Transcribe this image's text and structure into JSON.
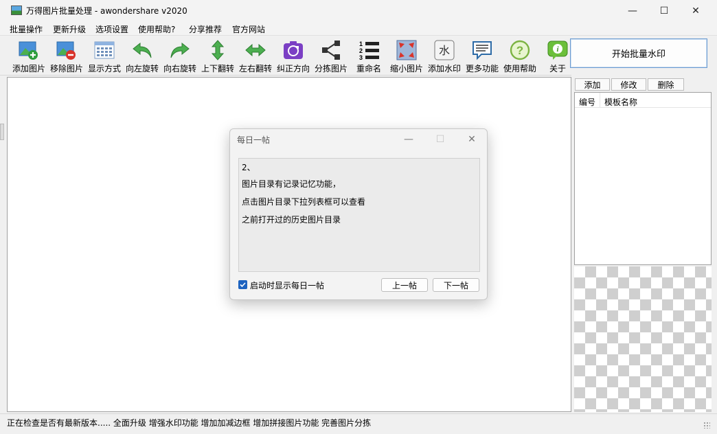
{
  "window": {
    "title": "万得图片批量处理 - awondershare v2020",
    "controls": {
      "minimize": "—",
      "maximize": "☐",
      "close": "✕"
    }
  },
  "menu": [
    "批量操作",
    "更新升级",
    "选项设置",
    "使用帮助?",
    "分享推荐",
    "官方网站"
  ],
  "toolbar": {
    "tools": [
      {
        "label": "添加图片",
        "icon": "add-image-icon"
      },
      {
        "label": "移除图片",
        "icon": "remove-image-icon"
      },
      {
        "label": "显示方式",
        "icon": "display-mode-icon"
      },
      {
        "label": "向左旋转",
        "icon": "rotate-left-icon"
      },
      {
        "label": "向右旋转",
        "icon": "rotate-right-icon"
      },
      {
        "label": "上下翻转",
        "icon": "flip-vertical-icon"
      },
      {
        "label": "左右翻转",
        "icon": "flip-horizontal-icon"
      },
      {
        "label": "纠正方向",
        "icon": "correct-orientation-icon"
      },
      {
        "label": "分拣图片",
        "icon": "sort-images-icon"
      },
      {
        "label": "重命名",
        "icon": "rename-icon",
        "glyph_numbers": [
          "1",
          "2",
          "3"
        ]
      },
      {
        "label": "缩小图片",
        "icon": "shrink-image-icon"
      },
      {
        "label": "添加水印",
        "icon": "add-watermark-icon",
        "glyph": "水"
      },
      {
        "label": "更多功能",
        "icon": "more-features-icon"
      },
      {
        "label": "使用帮助",
        "icon": "help-icon",
        "glyph": "?"
      },
      {
        "label": "关于",
        "icon": "about-icon",
        "glyph": "i"
      }
    ]
  },
  "start_button": "开始批量水印",
  "template_panel": {
    "buttons": {
      "add": "添加",
      "edit": "修改",
      "delete": "删除"
    },
    "columns": [
      "编号",
      "模板名称"
    ]
  },
  "status": "正在检查是否有最新版本..... 全面升级 增强水印功能 增加加减边框 增加拼接图片功能 完善图片分拣",
  "dialog": {
    "title": "每日一帖",
    "controls": {
      "minimize": "—",
      "maximize": "☐",
      "close": "✕"
    },
    "lines": [
      "2、",
      "图片目录有记录记忆功能，",
      "点击图片目录下拉列表框可以查看",
      "之前打开过的历史图片目录"
    ],
    "checkbox_label": "启动时显示每日一帖",
    "checkbox_checked": true,
    "prev": "上一帖",
    "next": "下一帖"
  },
  "colors": {
    "accent": "#1d63c0",
    "start_border": "#6b9bd1"
  }
}
